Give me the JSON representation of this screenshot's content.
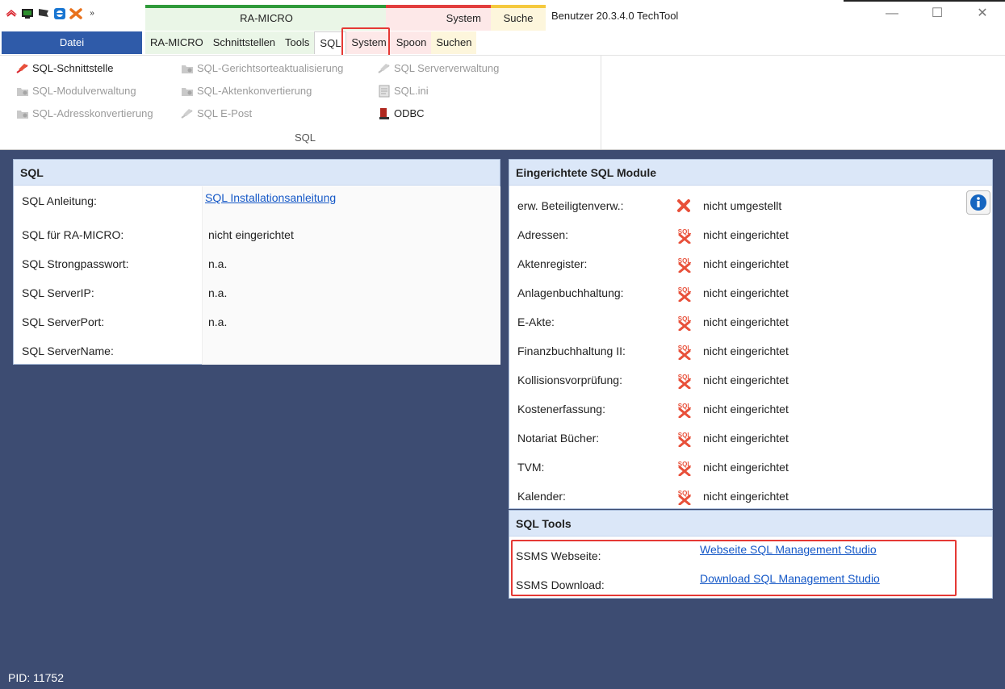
{
  "titlebar": {
    "file_tab": "Datei",
    "groups": {
      "ramicro": "RA-MICRO",
      "system": "System",
      "suche": "Suche"
    },
    "tabs": [
      "RA-MICRO",
      "Schnittstellen",
      "Tools",
      "SQL",
      "System",
      "Spoon",
      "Suchen"
    ],
    "selected_tab": "SQL",
    "app_title": "Benutzer 20.3.4.0 TechTool",
    "quick_icons": [
      "ramicro-logo-icon",
      "monitor-icon",
      "flag-icon",
      "teamviewer-icon",
      "tools-icon",
      "more-icon"
    ],
    "window_buttons": {
      "minimize": "—",
      "maximize": "☐",
      "close": "✕"
    }
  },
  "ribbon": {
    "group_label": "SQL",
    "items": [
      {
        "label": "SQL-Schnittstelle",
        "icon": "sql-interface-icon",
        "enabled": true
      },
      {
        "label": "SQL-Modulverwaltung",
        "icon": "folder-gear-icon",
        "enabled": false
      },
      {
        "label": "SQL-Adresskonvertierung",
        "icon": "folder-gear-icon",
        "enabled": false
      },
      {
        "label": "SQL-Gerichtsorteaktualisierung",
        "icon": "folder-gear-icon",
        "enabled": false
      },
      {
        "label": "SQL-Aktenkonvertierung",
        "icon": "folder-gear-icon",
        "enabled": false
      },
      {
        "label": "SQL E-Post",
        "icon": "sql-interface-icon",
        "enabled": false
      },
      {
        "label": "SQL Serververwaltung",
        "icon": "sql-interface-icon",
        "enabled": false
      },
      {
        "label": "SQL.ini",
        "icon": "ini-file-icon",
        "enabled": false
      },
      {
        "label": "ODBC",
        "icon": "odbc-icon",
        "enabled": true
      }
    ]
  },
  "sql_panel": {
    "title": "SQL",
    "rows": [
      {
        "label": "SQL Anleitung:",
        "value": "SQL Installationsanleitung",
        "link": true
      },
      {
        "label": "SQL für RA-MICRO:",
        "value": "nicht eingerichtet",
        "link": false
      },
      {
        "label": "SQL Strongpasswort:",
        "value": "n.a.",
        "link": false
      },
      {
        "label": "SQL ServerIP:",
        "value": "n.a.",
        "link": false
      },
      {
        "label": "SQL ServerPort:",
        "value": "n.a.",
        "link": false
      },
      {
        "label": "SQL ServerName:",
        "value": "",
        "link": false
      }
    ]
  },
  "modules_panel": {
    "title": "Eingerichtete SQL Module",
    "info_icon": "info-icon",
    "rows": [
      {
        "label": "erw. Beteiligtenverw.:",
        "status": "nicht umgestellt",
        "icon": "red-x-icon"
      },
      {
        "label": "Adressen:",
        "status": "nicht eingerichtet",
        "icon": "sql-x-icon"
      },
      {
        "label": "Aktenregister:",
        "status": "nicht eingerichtet",
        "icon": "sql-x-icon"
      },
      {
        "label": "Anlagenbuchhaltung:",
        "status": "nicht eingerichtet",
        "icon": "sql-x-icon"
      },
      {
        "label": "E-Akte:",
        "status": "nicht eingerichtet",
        "icon": "sql-x-icon"
      },
      {
        "label": "Finanzbuchhaltung II:",
        "status": "nicht eingerichtet",
        "icon": "sql-x-icon"
      },
      {
        "label": "Kollisionsvorprüfung:",
        "status": "nicht eingerichtet",
        "icon": "sql-x-icon"
      },
      {
        "label": "Kostenerfassung:",
        "status": "nicht eingerichtet",
        "icon": "sql-x-icon"
      },
      {
        "label": "Notariat Bücher:",
        "status": "nicht eingerichtet",
        "icon": "sql-x-icon"
      },
      {
        "label": "TVM:",
        "status": "nicht eingerichtet",
        "icon": "sql-x-icon"
      },
      {
        "label": "Kalender:",
        "status": "nicht eingerichtet",
        "icon": "sql-x-icon"
      }
    ]
  },
  "tools_panel": {
    "title": "SQL Tools",
    "rows": [
      {
        "label": "SSMS Webseite:",
        "value": "Webseite SQL Management Studio"
      },
      {
        "label": "SSMS Download:",
        "value": "Download SQL Management Studio"
      }
    ]
  },
  "status": {
    "pid": "PID: 11752"
  },
  "colors": {
    "background": "#3d4c72",
    "file_tab": "#2f5ba9",
    "panel_header": "#dbe7f8",
    "highlight": "#e53935",
    "link": "#1558c7"
  }
}
